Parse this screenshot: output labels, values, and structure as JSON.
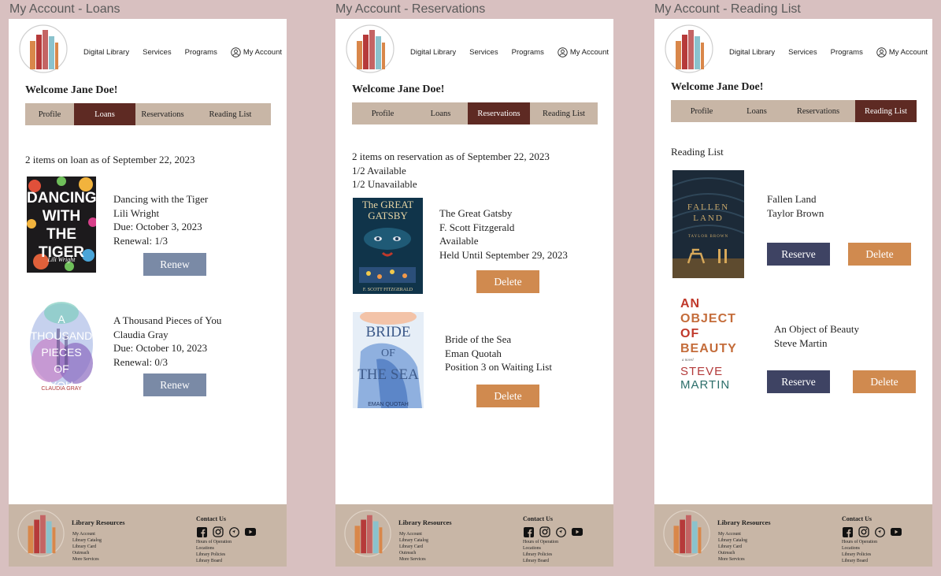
{
  "frames": [
    {
      "title": "My Account - Loans"
    },
    {
      "title": "My Account - Reservations"
    },
    {
      "title": "My Account - Reading List"
    }
  ],
  "nav": {
    "digital": "Digital Library",
    "services": "Services",
    "programs": "Programs",
    "account": "My Account"
  },
  "welcome": "Welcome Jane Doe!",
  "tabs": [
    "Profile",
    "Loans",
    "Reservations",
    "Reading List"
  ],
  "loans": {
    "summary": "2 items on loan as of September 22, 2023",
    "books": [
      {
        "cover_title": [
          "DANCING",
          "WITH THE",
          "TIGER"
        ],
        "cover_author": "Lili Wright",
        "title": "Dancing with the Tiger",
        "author": "Lili Wright",
        "due": "Due: October 3, 2023",
        "renewal": "Renewal: 1/3",
        "button": "Renew"
      },
      {
        "cover_title": [
          "A",
          "THOUSAND",
          "PIECES",
          "OF",
          "YOU"
        ],
        "cover_author": "CLAUDIA GRAY",
        "title": "A Thousand Pieces of You",
        "author": "Claudia Gray",
        "due": "Due: October 10, 2023",
        "renewal": "Renewal: 0/3",
        "button": "Renew"
      }
    ]
  },
  "reservations": {
    "summary": "2 items on reservation as of September 22, 2023",
    "available": "1/2 Available",
    "unavailable": "1/2 Unavailable",
    "books": [
      {
        "cover_title": [
          "The GREAT",
          "GATSBY"
        ],
        "cover_author": "F. SCOTT FITZGERALD",
        "title": "The Great Gatsby",
        "author": "F. Scott Fitzgerald",
        "status": "Available",
        "extra": "Held Until September 29, 2023",
        "button": "Delete"
      },
      {
        "cover_title": [
          "BRIDE",
          "OF",
          "THE SEA"
        ],
        "cover_author": "EMAN QUOTAH",
        "title": "Bride of the Sea",
        "author": "Eman Quotah",
        "status": "Position 3 on Waiting List",
        "button": "Delete"
      }
    ]
  },
  "reading": {
    "heading": "Reading List",
    "books": [
      {
        "cover_title": [
          "FALLEN",
          "LAND"
        ],
        "cover_author": "TAYLOR BROWN",
        "title": "Fallen Land",
        "author": "Taylor Brown",
        "reserve": "Reserve",
        "delete": "Delete"
      },
      {
        "cover_title": [
          "AN",
          "OBJECT",
          "OF",
          "BEAUTY"
        ],
        "cover_sub": "a novel",
        "cover_author": [
          "STEVE",
          "MARTIN"
        ],
        "title": "An Object of Beauty",
        "author": "Steve Martin",
        "reserve": "Reserve",
        "delete": "Delete"
      }
    ]
  },
  "footer": {
    "resources_title": "Library Resources",
    "resources": [
      "My Account",
      "Library Catalog",
      "Library Card",
      "Outreach",
      "More Services"
    ],
    "contact_title": "Contact Us",
    "contact": [
      "Hours of Operation",
      "Locations",
      "Library Policies",
      "Library Board"
    ]
  },
  "colors": {
    "active_tab": "#5e2a23",
    "tab_bar": "#c8b6a6",
    "renew": "#7a8aa6",
    "delete": "#d08a4f",
    "reserve": "#3e4363",
    "background": "#d8c0c0"
  }
}
